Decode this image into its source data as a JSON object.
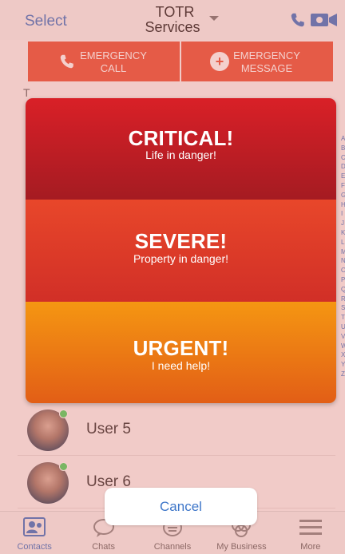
{
  "navbar": {
    "left_label": "Select",
    "title_line1": "TOTR",
    "title_line2": "Services"
  },
  "emergency": {
    "call_line1": "EMERGENCY",
    "call_line2": "CALL",
    "message_line1": "EMERGENCY",
    "message_line2": "MESSAGE"
  },
  "contacts": {
    "section_letter": "T",
    "rows": [
      {
        "name": "User 5",
        "online": true
      },
      {
        "name": "User 6",
        "online": true
      }
    ]
  },
  "alpha_index": [
    "A",
    "B",
    "C",
    "D",
    "E",
    "F",
    "G",
    "H",
    "I",
    "J",
    "K",
    "L",
    "M",
    "N",
    "O",
    "P",
    "Q",
    "R",
    "S",
    "T",
    "U",
    "V",
    "W",
    "X",
    "Y",
    "Z"
  ],
  "severity": {
    "critical": {
      "title": "CRITICAL!",
      "subtitle": "Life in danger!"
    },
    "severe": {
      "title": "SEVERE!",
      "subtitle": "Property in danger!"
    },
    "urgent": {
      "title": "URGENT!",
      "subtitle": "I need help!"
    }
  },
  "cancel_label": "Cancel",
  "tabs": [
    {
      "label": "Contacts",
      "icon": "contacts-icon"
    },
    {
      "label": "Chats",
      "icon": "chats-icon"
    },
    {
      "label": "Channels",
      "icon": "channels-icon"
    },
    {
      "label": "My Business",
      "icon": "business-icon"
    },
    {
      "label": "More",
      "icon": "menu-icon"
    }
  ],
  "colors": {
    "accent": "#3f77c9",
    "critical": "#c41e25",
    "severe": "#e03b28",
    "urgent": "#ee7b14",
    "presence": "#4cd964"
  }
}
